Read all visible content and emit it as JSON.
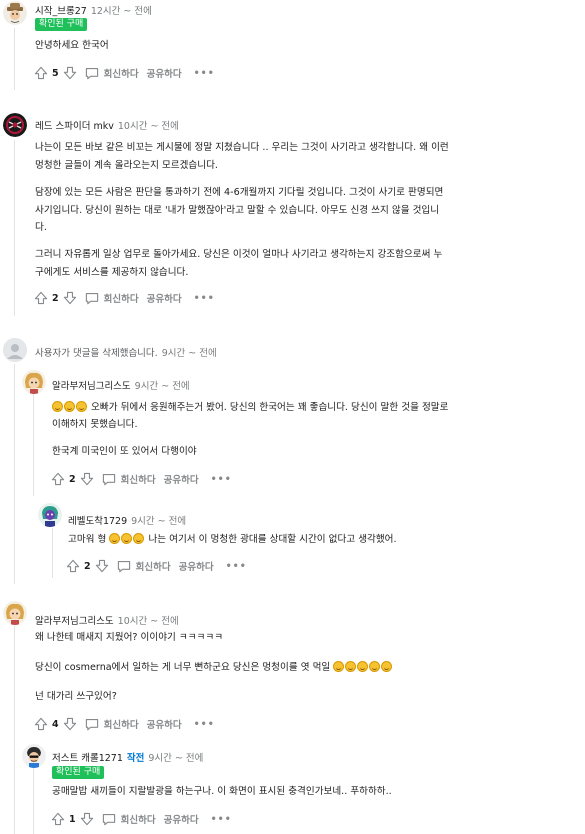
{
  "comments": [
    {
      "id": "c1",
      "username": "시작_브롱27",
      "time": "12시간 ~ 전에",
      "flair": "확인된 구매",
      "lines": [
        "안녕하세요 한국어"
      ],
      "votes": "5",
      "reply_label": "회신하다",
      "share_label": "공유하다",
      "more_label": "•••"
    },
    {
      "id": "c2",
      "username": "레드 스파이더 mkv",
      "time": "10시간 ~ 전에",
      "paragraphs": [
        [
          "나는이 모든 바보 같은 비꼬는 게시물에 정말 지쳤습니다 .. 우리는 그것이 사기라고 생각합니다. 왜 이런",
          "멍청한 글들이 계속 올라오는지 모르겠습니다."
        ],
        [
          "담장에 있는 모든 사람은 판단을 통과하기 전에 4-6개월까지 기다릴 것입니다. 그것이 사기로 판명되면",
          "사기입니다. 당신이 원하는 대로 '내가 말했잖아'라고 말할 수 있습니다. 아무도 신경 쓰지 않을 것입니",
          "다."
        ],
        [
          "그러니 자유롭게 일상 업무로 돌아가세요. 당신은 이것이 얼마나 사기라고 생각하는지 강조함으로써 누",
          "구에게도 서비스를 제공하지 않습니다."
        ]
      ],
      "votes": "2",
      "reply_label": "회신하다",
      "share_label": "공유하다",
      "more_label": "•••"
    },
    {
      "id": "c3",
      "deleted_text": "사용자가 댓글을 삭제했습니다.",
      "time": "9시간 ~ 전에"
    },
    {
      "id": "c4",
      "username": "알라부저님그리스도",
      "time": "9시간 ~ 전에",
      "line1_text": " 오빠가 뒤에서 응원해주는거 봤어. 당신의 한국어는 꽤 좋습니다. 당신이 말한 것을 정말로",
      "line2_text": "이해하지 못했습니다.",
      "line3_text": "한국계 미국인이 또 있어서 다행이야",
      "votes": "2",
      "reply_label": "회신하다",
      "share_label": "공유하다",
      "more_label": "•••"
    },
    {
      "id": "c5",
      "username": "레벨도착1729",
      "time": "9시간 ~ 전에",
      "text_before": "고마워 형 ",
      "text_after": " 나는 여기서 이 멍청한 광대를 상대할 시간이 없다고 생각했어.",
      "votes": "2",
      "reply_label": "회신하다",
      "share_label": "공유하다",
      "more_label": "•••"
    },
    {
      "id": "c6",
      "username": "알라부저님그리스도",
      "time": "10시간 ~ 전에",
      "line1_text": "왜 나한테 매새지 지웠어? 이이야기 ㅋㅋㅋㅋㅋ",
      "line2_text": "당신이 cosmerna에서 일하는 게 너무 뻔하군요 당신은 멍청이를 엿 먹일 ",
      "line3_text": "넌 대가리 쓰구있어?",
      "votes": "4",
      "reply_label": "회신하다",
      "share_label": "공유하다",
      "more_label": "•••"
    },
    {
      "id": "c7",
      "username": "저스트 캐롤1271",
      "op_label": "작전",
      "time": "9시간 ~ 전에",
      "flair": "확인된 구매",
      "lines": [
        "공매말밥 새끼들이 지랄발광을 하는구나. 이 화면이 표시된 충격인가보네.. 푸하하하.."
      ],
      "votes": "1",
      "reply_label": "회신하다",
      "share_label": "공유하다",
      "more_label": "•••"
    }
  ],
  "colors": {
    "flair": "#1fbf5a",
    "meta": "#787c7e",
    "op": "#0079d3"
  }
}
